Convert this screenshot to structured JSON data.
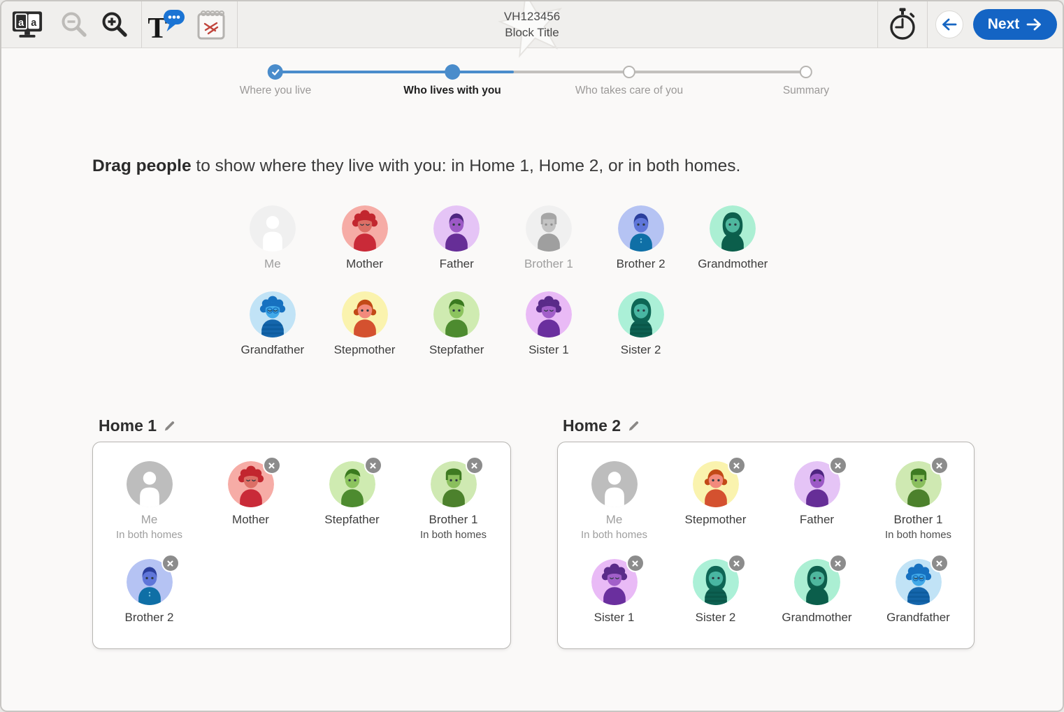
{
  "toolbar": {
    "title_line1": "VH123456",
    "title_line2": "Block Title",
    "next_label": "Next",
    "icons": [
      "display-settings",
      "zoom-out",
      "zoom-in",
      "text-to-speech",
      "scratchpad",
      "timer",
      "back",
      "next"
    ]
  },
  "stepper": {
    "accent": "#4A8CCB",
    "steps": [
      {
        "label": "Where you live",
        "state": "complete"
      },
      {
        "label": "Who lives with you",
        "state": "active"
      },
      {
        "label": "Who takes care of you",
        "state": "upcoming"
      },
      {
        "label": "Summary",
        "state": "upcoming"
      }
    ]
  },
  "instruction": {
    "bold": "Drag people",
    "rest": " to show where they live with you: in Home 1, Home 2, or in both homes."
  },
  "labels": {
    "in_both_homes": "In both homes"
  },
  "colors": {
    "accent_blue": "#4A8CCB",
    "next_button_blue": "#1464C4",
    "back_arrow_blue": "#1766C2",
    "toolbar_bg": "#F0EFED",
    "page_bg": "#FAF9F8",
    "remove_badge_gray": "#8C8C8C"
  },
  "disabled_palette": {
    "bg": "#F0F0F0",
    "hair": "#A6A6A6",
    "skin": "#C3C3C3",
    "shirt": "#9F9F9F",
    "eye": "#8F8F8F"
  },
  "people": {
    "me": {
      "label": "Me",
      "style": "generic",
      "bg": "#BDBDBD"
    },
    "mother": {
      "label": "Mother",
      "style": "figure",
      "hair_style": "curly",
      "eyes": "closed",
      "bg": "#F6ACA6",
      "hair": "#C2262E",
      "skin": "#DC6F66",
      "shirt": "#C92A38"
    },
    "father": {
      "label": "Father",
      "style": "figure",
      "hair_style": "short",
      "eyes": "open",
      "bg": "#E5C4F6",
      "hair": "#4E2580",
      "skin": "#9C59C6",
      "shirt": "#662E97"
    },
    "brother1": {
      "label": "Brother 1",
      "style": "figure",
      "hair_style": "flat",
      "eyes": "open",
      "bg": "#CFE9B2",
      "hair": "#3E7A22",
      "skin": "#8ABE5D",
      "shirt": "#4C812C"
    },
    "brother2": {
      "label": "Brother 2",
      "style": "figure",
      "hair_style": "short",
      "eyes": "open",
      "bg": "#B5C3F3",
      "hair": "#2A3E9C",
      "skin": "#5F76D9",
      "shirt": "#0F6FA6",
      "buttons": "#7AC5E2"
    },
    "grandmother": {
      "label": "Grandmother",
      "style": "figure",
      "hair_style": "bob",
      "eyes": "open",
      "bg": "#ABEFD3",
      "hair": "#0D5F4D",
      "skin": "#4FB79E",
      "shirt": "#0B5E4B"
    },
    "grandfather": {
      "label": "Grandfather",
      "style": "figure",
      "hair_style": "curly",
      "eyes": "closed",
      "glasses": true,
      "stripe": "#0E5C9E",
      "bg": "#C1E3F6",
      "hair": "#1671C0",
      "skin": "#41A9E8",
      "shirt": "#1566AC"
    },
    "stepmother": {
      "label": "Stepmother",
      "style": "figure",
      "hair_style": "side",
      "eyes": "open",
      "bg": "#FAF3AE",
      "hair": "#C24A17",
      "skin": "#F28A7C",
      "shirt": "#D4512F"
    },
    "stepfather": {
      "label": "Stepfather",
      "style": "figure",
      "hair_style": "swoop",
      "eyes": "open",
      "bg": "#CFEBB1",
      "hair": "#3A7A1F",
      "skin": "#8CC35E",
      "shirt": "#4D8B2F"
    },
    "sister1": {
      "label": "Sister 1",
      "style": "figure",
      "hair_style": "curly",
      "eyes": "closed",
      "bg": "#E9BAF6",
      "hair": "#5A2B89",
      "skin": "#A25FC9",
      "shirt": "#6A2F9E"
    },
    "sister2": {
      "label": "Sister 2",
      "style": "figure",
      "hair_style": "bob",
      "eyes": "open",
      "stripe": "#0A5748",
      "bg": "#ABF0D7",
      "hair": "#0E6655",
      "skin": "#49B6A2",
      "shirt": "#0D6152"
    }
  },
  "tray": {
    "rows": [
      [
        "me",
        "mother",
        "father",
        "brother1",
        "brother2",
        "grandmother"
      ],
      [
        "grandfather",
        "stepmother",
        "stepfather",
        "sister1",
        "sister2"
      ]
    ],
    "disabled": [
      "me",
      "brother1"
    ]
  },
  "homes": [
    {
      "title": "Home 1",
      "rows": [
        [
          {
            "id": "me",
            "removable": false,
            "note": true
          },
          {
            "id": "mother",
            "removable": true
          },
          {
            "id": "stepfather",
            "removable": true
          },
          {
            "id": "brother1",
            "removable": true,
            "note": true
          }
        ],
        [
          {
            "id": "brother2",
            "removable": true
          }
        ]
      ]
    },
    {
      "title": "Home 2",
      "rows": [
        [
          {
            "id": "me",
            "removable": false,
            "note": true
          },
          {
            "id": "stepmother",
            "removable": true
          },
          {
            "id": "father",
            "removable": true
          },
          {
            "id": "brother1",
            "removable": true,
            "note": true
          }
        ],
        [
          {
            "id": "sister1",
            "removable": true
          },
          {
            "id": "sister2",
            "removable": true
          },
          {
            "id": "grandmother",
            "removable": true
          },
          {
            "id": "grandfather",
            "removable": true
          }
        ]
      ]
    }
  ]
}
